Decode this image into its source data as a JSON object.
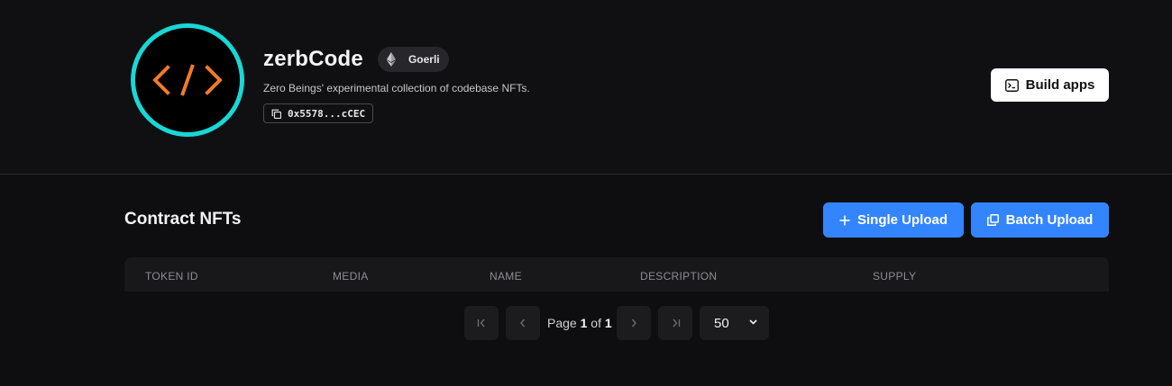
{
  "header": {
    "title": "zerbCode",
    "network_badge": "Goerli",
    "description": "Zero Beings' experimental collection of codebase NFTs.",
    "contract_address": "0x5578...cCEC",
    "logo_text": "</>",
    "build_button": "Build apps"
  },
  "section": {
    "title": "Contract NFTs",
    "single_upload_button": "Single Upload",
    "batch_upload_button": "Batch Upload"
  },
  "table": {
    "columns": [
      "TOKEN ID",
      "MEDIA",
      "NAME",
      "DESCRIPTION",
      "SUPPLY"
    ],
    "rows": []
  },
  "pagination": {
    "page_label": "Page",
    "current_page": "1",
    "of_label": "of",
    "total_pages": "1",
    "page_size": "50"
  },
  "colors": {
    "background": "#0e0e10",
    "accent_blue": "#3385ff",
    "logo_ring": "#19d7d6",
    "logo_code": "#f07a2b"
  },
  "icons": [
    "ethereum-icon",
    "copy-icon",
    "terminal-icon",
    "plus-icon",
    "copy-stack-icon",
    "first-page-icon",
    "prev-page-icon",
    "next-page-icon",
    "last-page-icon",
    "chevron-down-icon"
  ]
}
